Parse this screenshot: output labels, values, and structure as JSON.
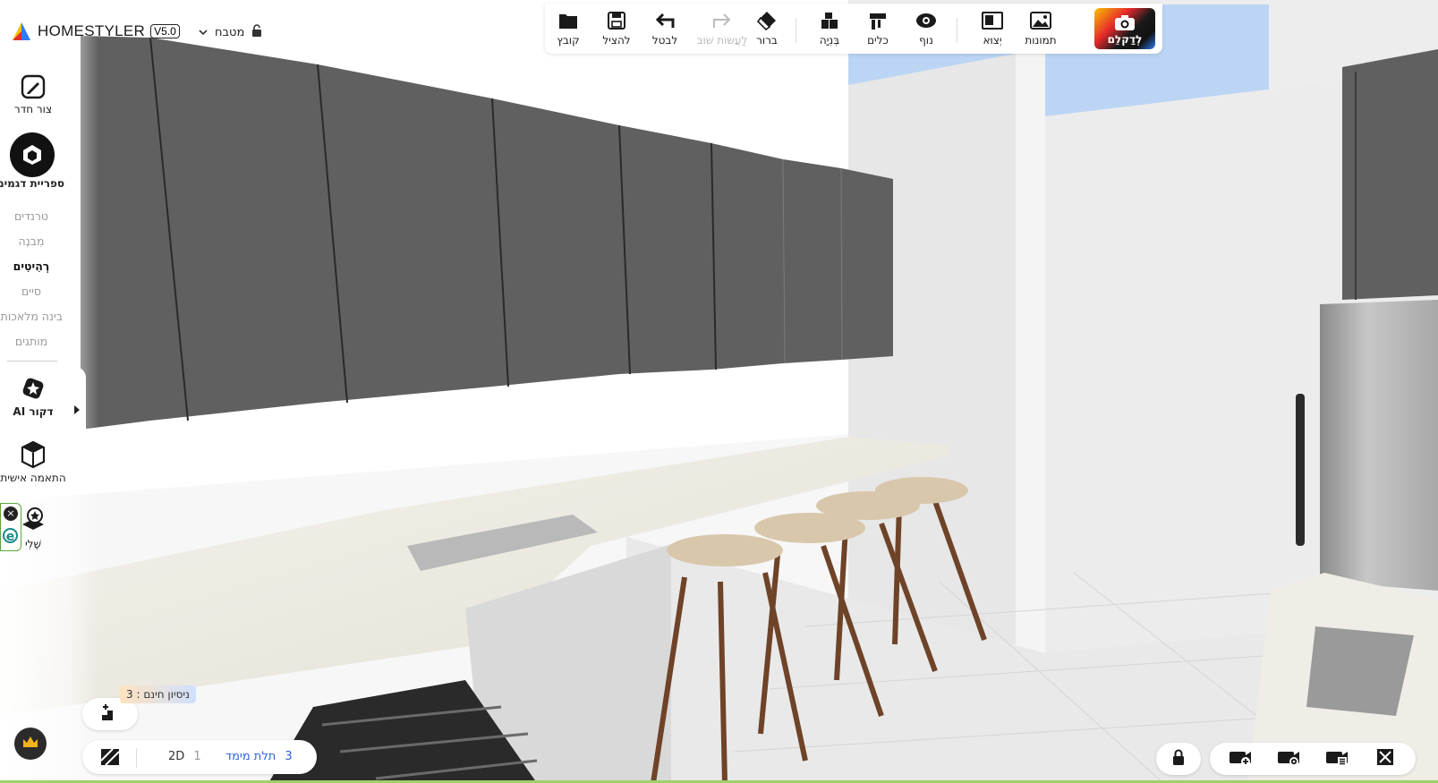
{
  "app": {
    "logo_text": "HOMESTYLER",
    "version": "V5.0",
    "room_name": "מטבח"
  },
  "toolbar": {
    "file": "קובץ",
    "save": "להציל",
    "undo": "לבטל",
    "redo": "לַעֲשׂוֹת שׁוּב",
    "erase": "ברור",
    "build": "בְּנִיָה",
    "tools": "כלים",
    "view": "נוף",
    "export": "יְצוּא",
    "images": "תמונות",
    "render": "לְדַקלֵם"
  },
  "sidebar": {
    "draw_room": "צור חדר",
    "model_library": "ספריית דגמים",
    "sub_items": [
      "טרנדים",
      "מִבנֶה",
      "רְהִיטִים",
      "סיים",
      "בינה מלאכותית",
      "מותגים"
    ],
    "ai_decor": "דקור AI",
    "customize": "התאמה אישית",
    "mine": "שֶׁלִי",
    "badge_letter": "e"
  },
  "bottom": {
    "trial_text": "ניסיון חינם : 3",
    "view_2d_num": "1",
    "view_2d": "2D",
    "view_3d_num": "3",
    "view_3d": "תלת מימד"
  },
  "colors": {
    "accent_blue": "#2a63d8",
    "cabinet_gray": "#5f605f",
    "sky_blue": "#bcd5f5"
  }
}
